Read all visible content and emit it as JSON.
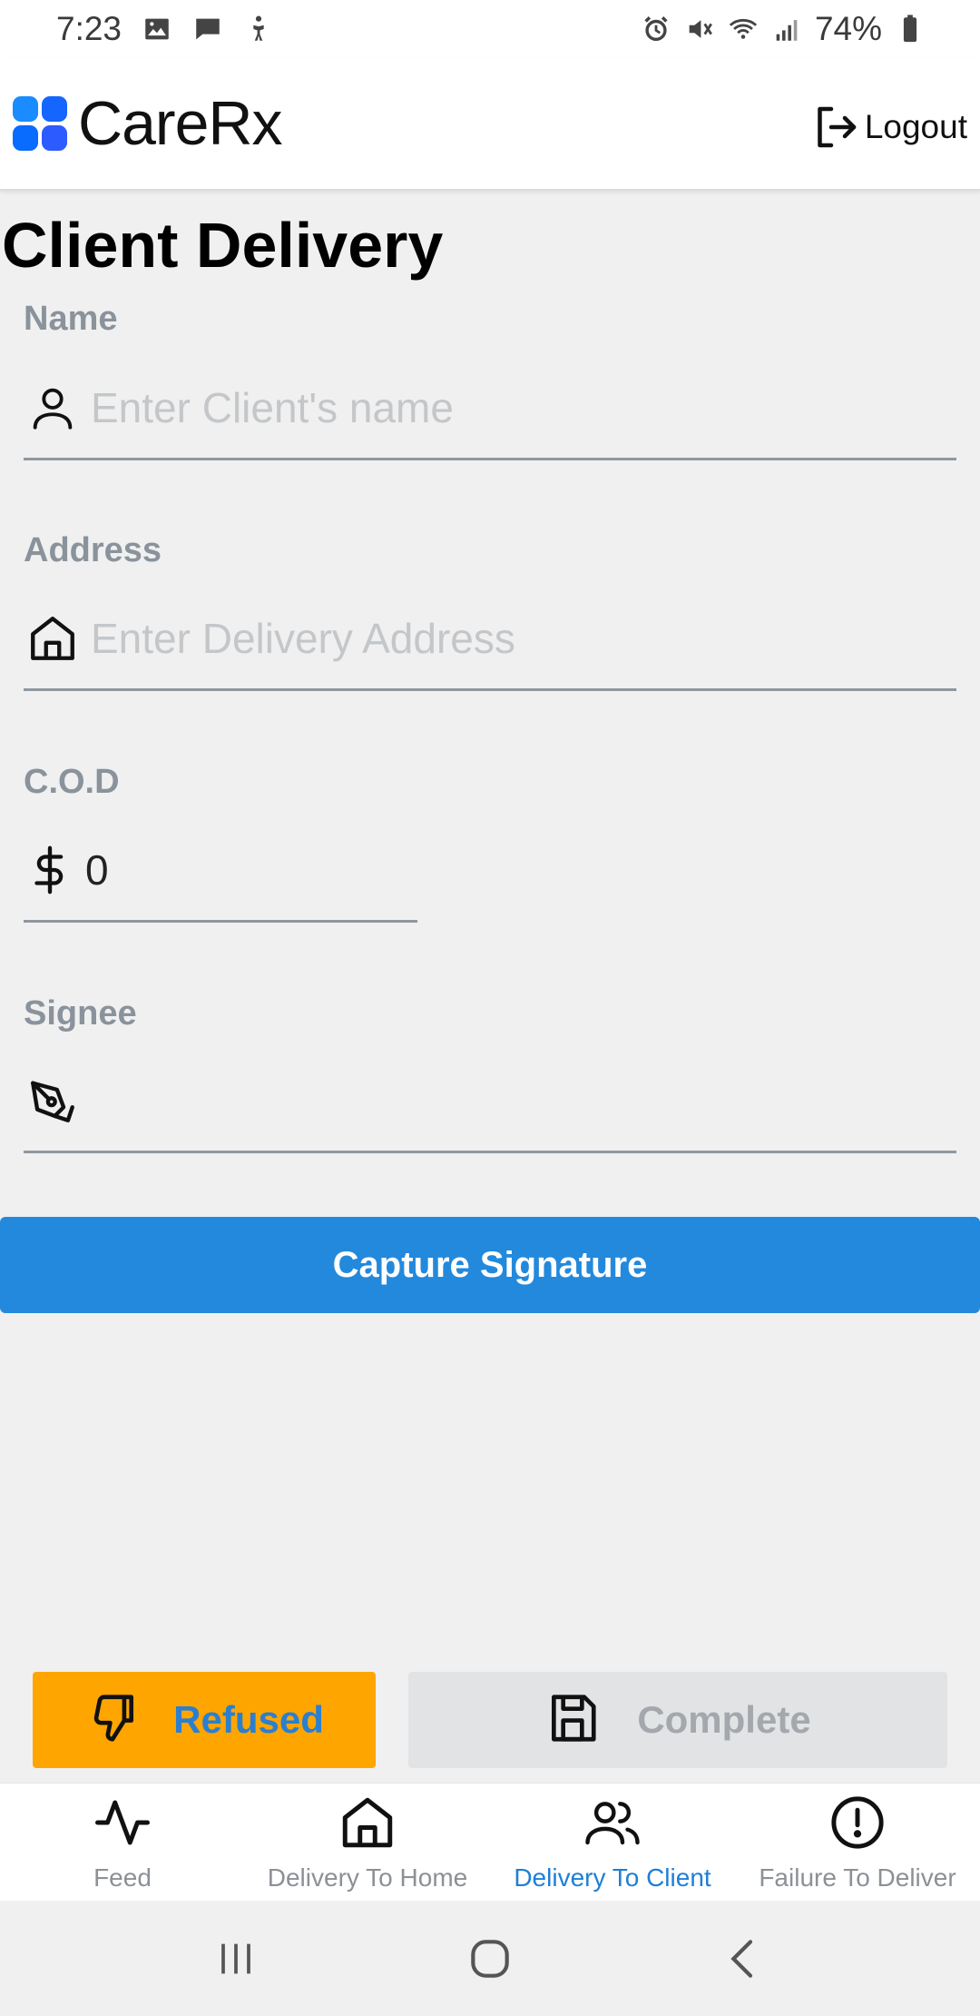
{
  "status_bar": {
    "time": "7:23",
    "battery": "74%",
    "left_icons": [
      "gallery-icon",
      "message-icon",
      "accessibility-icon"
    ],
    "right_icons": [
      "alarm-icon",
      "mute-icon",
      "wifi-icon",
      "signal-icon",
      "battery-icon"
    ]
  },
  "header": {
    "logo_text_main": "Care",
    "logo_text_rx": "Rx",
    "logo_colors": [
      "#1a8cff",
      "#1565ff",
      "#0a6bff",
      "#2c5bff"
    ],
    "logout_label": "Logout"
  },
  "page": {
    "title": "Client Delivery"
  },
  "form": {
    "name": {
      "label": "Name",
      "placeholder": "Enter Client's name",
      "value": ""
    },
    "address": {
      "label": "Address",
      "placeholder": "Enter Delivery Address",
      "value": ""
    },
    "cod": {
      "label": "C.O.D",
      "value": "0"
    },
    "signee": {
      "label": "Signee",
      "value": ""
    }
  },
  "actions": {
    "capture_signature": "Capture Signature",
    "refused": "Refused",
    "complete": "Complete"
  },
  "bottom_nav": {
    "items": [
      {
        "label": "Feed",
        "icon": "activity-icon",
        "active": false
      },
      {
        "label": "Delivery To Home",
        "icon": "home-icon",
        "active": false
      },
      {
        "label": "Delivery To Client",
        "icon": "users-icon",
        "active": true
      },
      {
        "label": "Failure To Deliver",
        "icon": "alert-circle-icon",
        "active": false
      }
    ]
  },
  "colors": {
    "primary": "#2389dc",
    "refused": "#ffa500",
    "active_nav": "#1e7fd6",
    "label_gray": "#8a939c"
  }
}
